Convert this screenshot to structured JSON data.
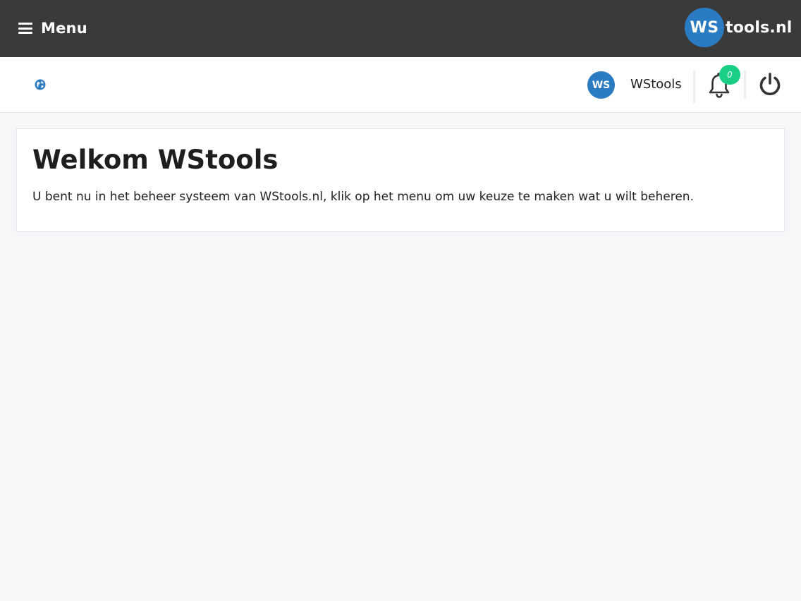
{
  "header": {
    "menu_label": "Menu",
    "brand": {
      "badge": "WS",
      "text": "tools.nl"
    }
  },
  "userbar": {
    "avatar_initials": "WS",
    "username": "WStools",
    "notification_count": "0"
  },
  "main": {
    "title": "Welkom WStools",
    "body": "U bent nu in het beheer systeem van WStools.nl, klik op het menu om uw keuze te maken wat u wilt beheren."
  },
  "icons": {
    "menu": "hamburger-icon",
    "language": "globe-icon",
    "notifications": "bell-icon",
    "logout": "power-icon"
  },
  "colors": {
    "topbar": "#3a3a3a",
    "brand_blue": "#2a7bc1",
    "badge_green": "#19cf86",
    "background": "#f7f7f9"
  }
}
